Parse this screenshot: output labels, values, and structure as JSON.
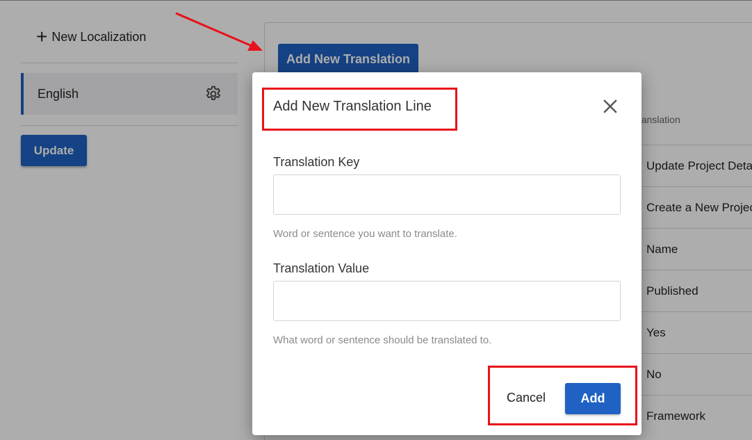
{
  "sidebar": {
    "new_localization_label": "New Localization",
    "language_item": "English",
    "update_label": "Update"
  },
  "main": {
    "add_translation_label": "Add New Translation",
    "column_header": "Translation",
    "rows": [
      "Update Project Details",
      "Create a New Project",
      "Name",
      "Published",
      "Yes",
      "No",
      "Framework"
    ]
  },
  "modal": {
    "title": "Add New Translation Line",
    "key_label": "Translation Key",
    "key_value": "",
    "key_hint": "Word or sentence you want to translate.",
    "value_label": "Translation Value",
    "value_value": "",
    "value_hint": "What word or sentence should be translated to.",
    "cancel_label": "Cancel",
    "add_label": "Add"
  },
  "icons": {
    "plus": "plus-icon",
    "gear": "gear-icon",
    "close": "close-icon"
  },
  "colors": {
    "accent": "#1f62c3",
    "annotation": "#e8121b",
    "active_indicator": "#1f5fbf"
  }
}
